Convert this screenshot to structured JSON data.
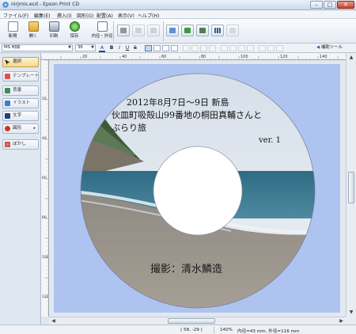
{
  "window": {
    "title": "nirjmis.ecd - Epson Print CD"
  },
  "menu": [
    "ファイル(F)",
    "編集(E)",
    "挿入(I)",
    "図形(G)",
    "配置(A)",
    "表示(V)",
    "ヘルプ(H)"
  ],
  "toolbar": {
    "buttons": [
      "新規",
      "開く",
      "印刷",
      "保存",
      "内径・外径"
    ]
  },
  "format": {
    "font": "MS 明朝",
    "size": "36",
    "bold": "B",
    "italic": "I",
    "underline": "U",
    "strike": "S",
    "hide_tools": "補助ツール"
  },
  "sidebar": {
    "items": [
      "選択",
      "テンプレート",
      "背景",
      "イラスト",
      "文字",
      "図形",
      "ぼかし"
    ]
  },
  "ruler": {
    "top": [
      "20",
      "40",
      "60",
      "80",
      "100",
      "120",
      "140"
    ],
    "left": [
      "20",
      "40",
      "60",
      "80",
      "100",
      "120"
    ]
  },
  "disc": {
    "line1": "2012年8月7日～9日 新島",
    "line2": "伙皿町吸殻山99番地の桐田真輔さんと",
    "line3": "ぶらり旅",
    "version": "ver. 1",
    "credit": "撮影：清水鱗造"
  },
  "status": {
    "coords": "( 58, -29 )",
    "zoom": "140%",
    "diameters": "内径=43 mm, 外径=116 mm"
  },
  "colors": {
    "paper": "#aec3f0",
    "accent": "#3b7bd1",
    "active_tool": "#f5d98c"
  }
}
